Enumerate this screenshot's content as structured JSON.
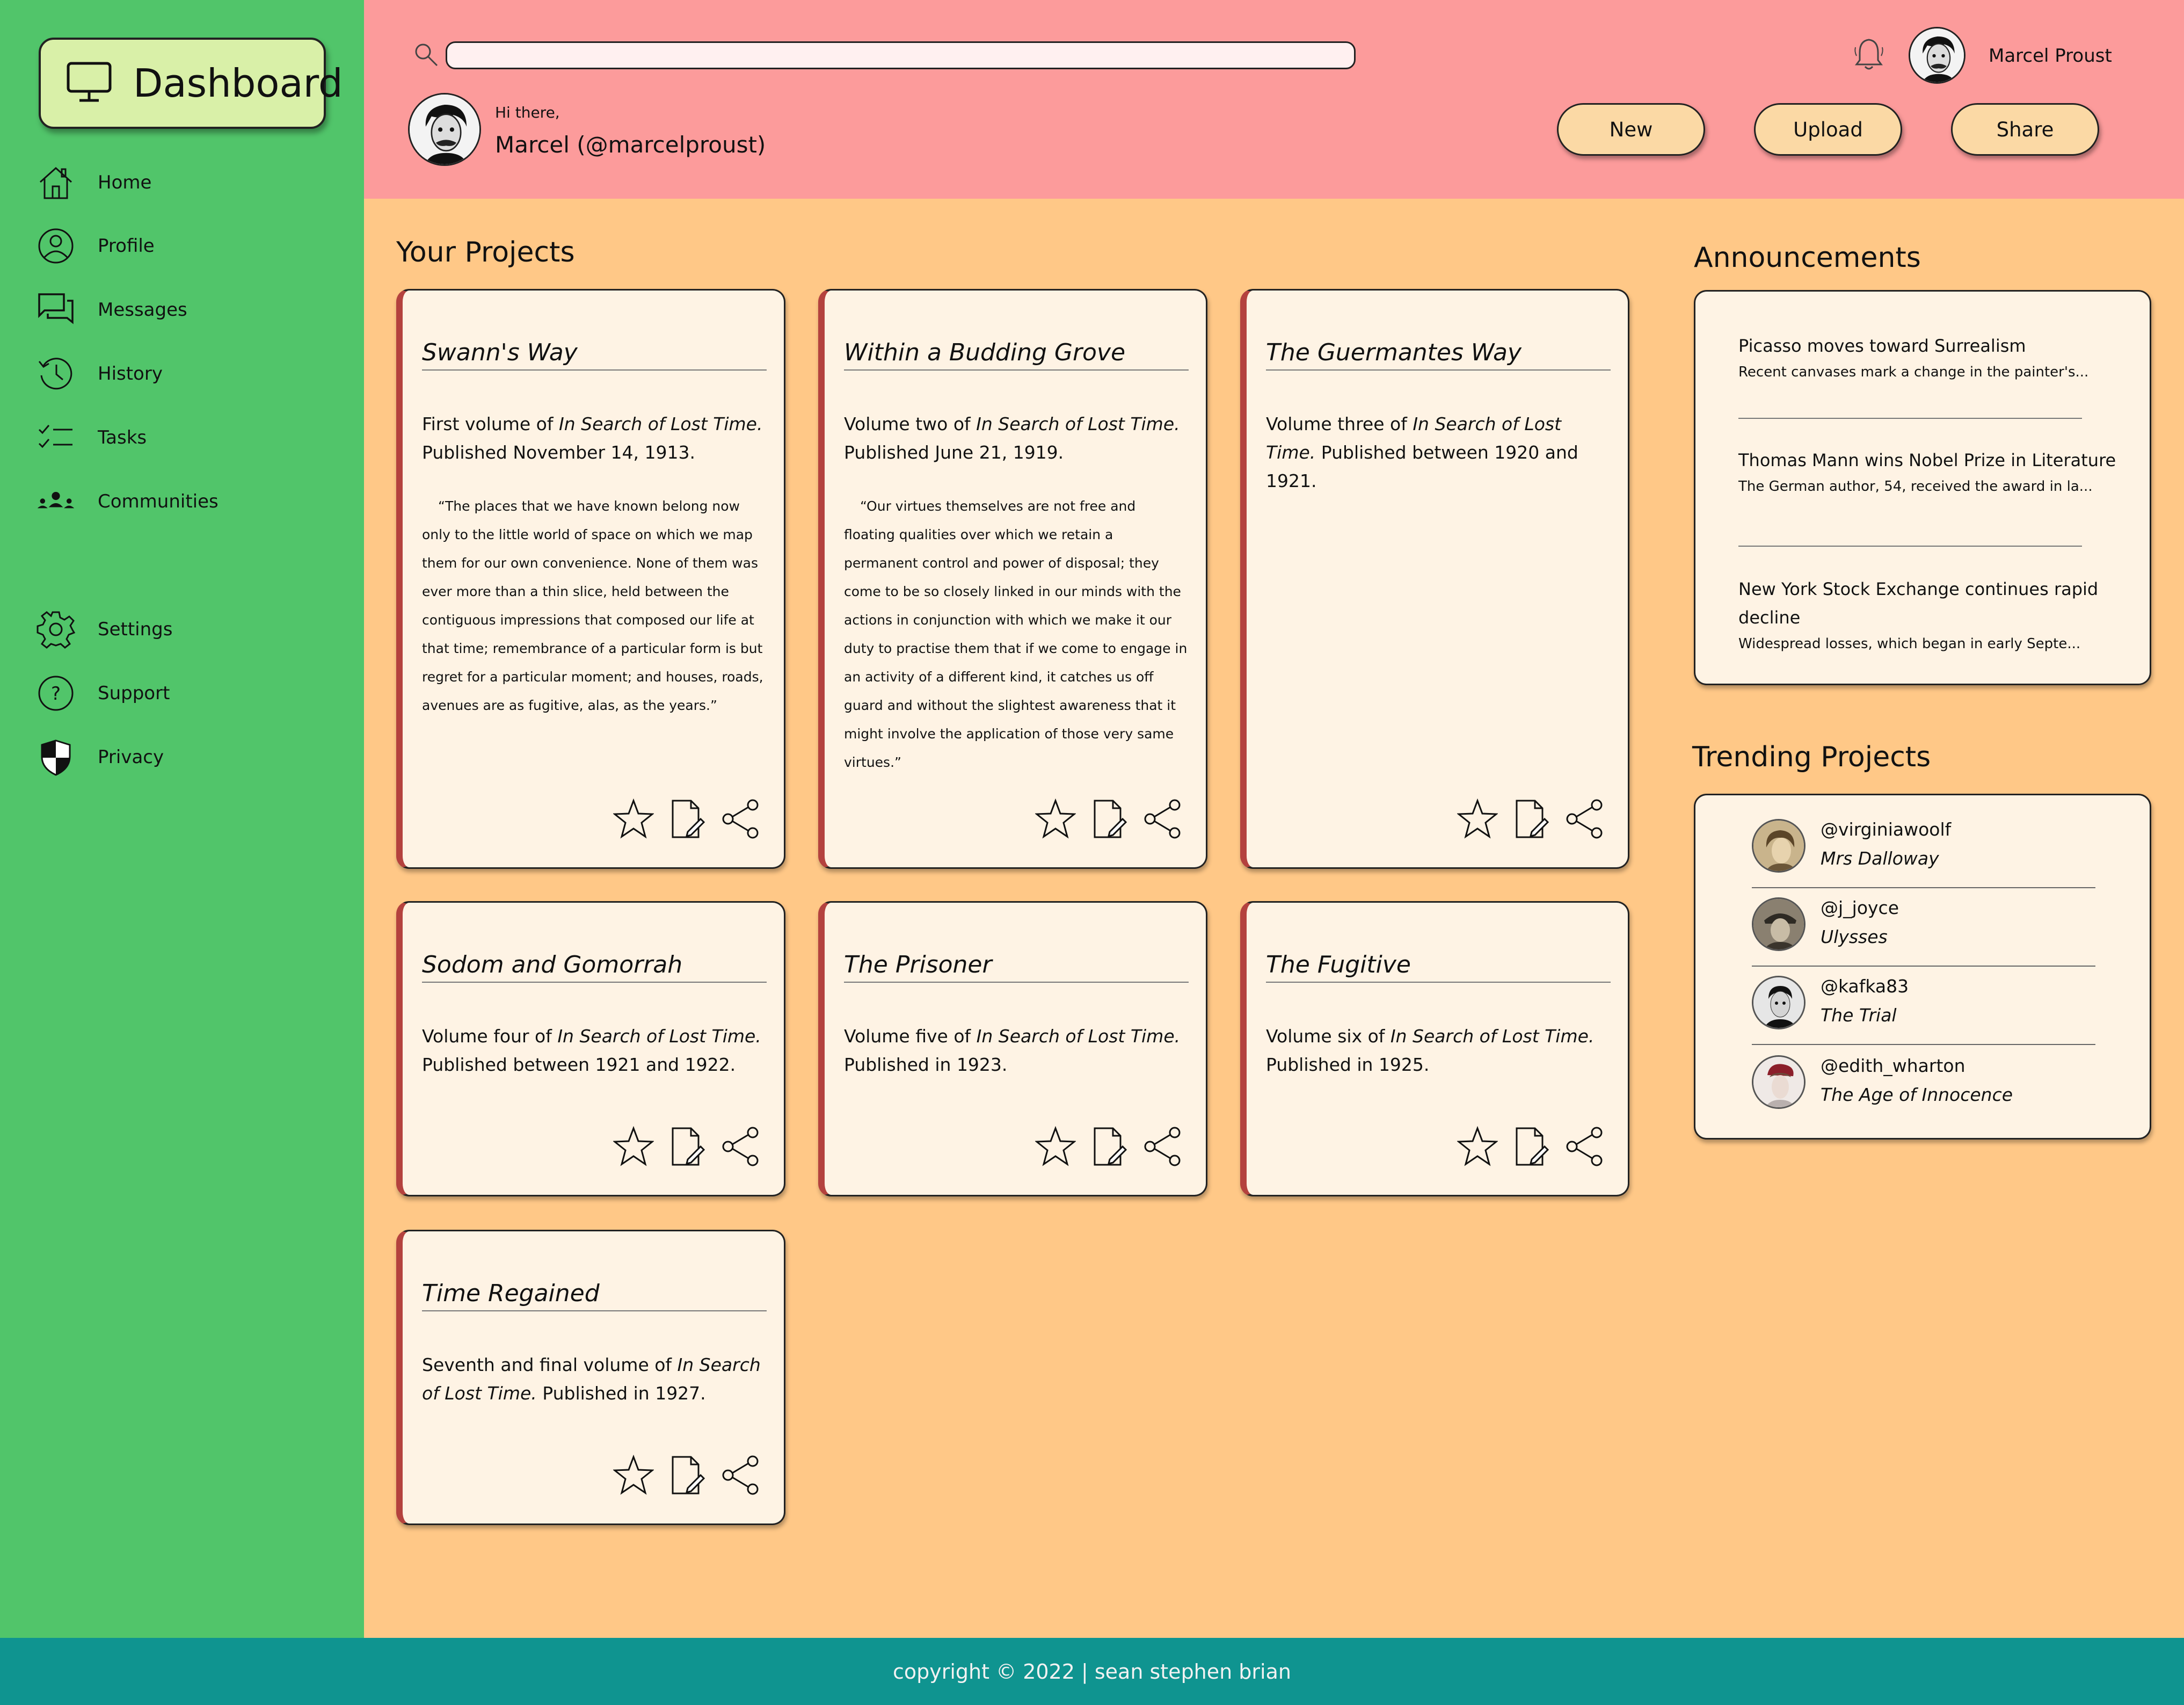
{
  "sidebar": {
    "logo_label": "Dashboard",
    "items": [
      {
        "label": "Home",
        "icon": "home-icon"
      },
      {
        "label": "Profile",
        "icon": "profile-icon"
      },
      {
        "label": "Messages",
        "icon": "messages-icon"
      },
      {
        "label": "History",
        "icon": "history-icon"
      },
      {
        "label": "Tasks",
        "icon": "tasks-icon"
      },
      {
        "label": "Communities",
        "icon": "communities-icon"
      },
      {
        "label": "Settings",
        "icon": "gear-icon"
      },
      {
        "label": "Support",
        "icon": "help-icon"
      },
      {
        "label": "Privacy",
        "icon": "shield-icon"
      }
    ]
  },
  "header": {
    "search_value": "",
    "user_name": "Marcel Proust",
    "greeting": "Hi there,",
    "handle": "Marcel (@marcelproust)",
    "buttons": {
      "new": "New",
      "upload": "Upload",
      "share": "Share"
    }
  },
  "projects": {
    "title": "Your Projects",
    "cards": [
      {
        "title": "Swann's Way",
        "desc_pre": "First volume of ",
        "desc_em": "In Search of Lost Time.",
        "desc_post": " Published November 14, 1913.",
        "quote": "“The places that we have known belong now only to the little world of space on which we map them for our own convenience. None of them was ever more than a thin slice, held between the contiguous impressions that composed our life at that time; remembrance of a particular form is but regret for a particular moment; and houses, roads, avenues are as fugitive, alas, as the years.”"
      },
      {
        "title": "Within a Budding Grove",
        "desc_pre": "Volume two of ",
        "desc_em": "In Search of Lost Time.",
        "desc_post": " Published June 21, 1919.",
        "quote": "“Our virtues themselves are not free and floating qualities over which we retain a permanent control and power of disposal; they come to be so closely linked in our minds with the actions in conjunction with which we make it our duty to practise them that if we come to engage in an activity of a different kind, it catches us off guard and without the slightest awareness that it might involve the application of those very same virtues.”"
      },
      {
        "title": "The Guermantes Way",
        "desc_pre": "Volume three of ",
        "desc_em": "In Search of Lost Time.",
        "desc_post": " Published between 1920 and 1921.",
        "quote": ""
      },
      {
        "title": "Sodom and Gomorrah",
        "desc_pre": "Volume four of ",
        "desc_em": "In Search of Lost Time.",
        "desc_post": " Published between 1921 and 1922.",
        "quote": ""
      },
      {
        "title": "The Prisoner",
        "desc_pre": "Volume five of ",
        "desc_em": "In Search of Lost Time.",
        "desc_post": " Published in 1923.",
        "quote": ""
      },
      {
        "title": "The Fugitive",
        "desc_pre": "Volume six of ",
        "desc_em": "In Search of Lost Time.",
        "desc_post": " Published in 1925.",
        "quote": ""
      },
      {
        "title": "Time Regained",
        "desc_pre": "Seventh and final volume of ",
        "desc_em": "In Search of Lost Time.",
        "desc_post": " Published in 1927.",
        "quote": ""
      }
    ]
  },
  "announcements": {
    "title": "Announcements",
    "items": [
      {
        "headline": "Picasso moves toward Surrealism",
        "summary": "Recent canvases mark a change in the painter's..."
      },
      {
        "headline": "Thomas Mann wins Nobel Prize in Literature",
        "summary": "The German author, 54, received the award in la..."
      },
      {
        "headline": "New York Stock Exchange continues rapid decline",
        "summary": "Widespread losses, which began in early Septe..."
      }
    ]
  },
  "trending": {
    "title": "Trending Projects",
    "items": [
      {
        "user": "@virginiawoolf",
        "book": "Mrs Dalloway"
      },
      {
        "user": "@j_joyce",
        "book": "Ulysses"
      },
      {
        "user": "@kafka83",
        "book": "The Trial"
      },
      {
        "user": "@edith_wharton",
        "book": "The Age of Innocence"
      }
    ]
  },
  "footer": {
    "text": "copyright © 2022 | sean stephen brian"
  },
  "colors": {
    "sidebar": "#51c56a",
    "header": "#fc9b9b",
    "main": "#ffc887",
    "card": "#fef3e4",
    "card_accent": "#b4423e",
    "footer": "#0f9490",
    "logo_button": "#d9f0a8",
    "header_button": "#fbd9a5"
  }
}
